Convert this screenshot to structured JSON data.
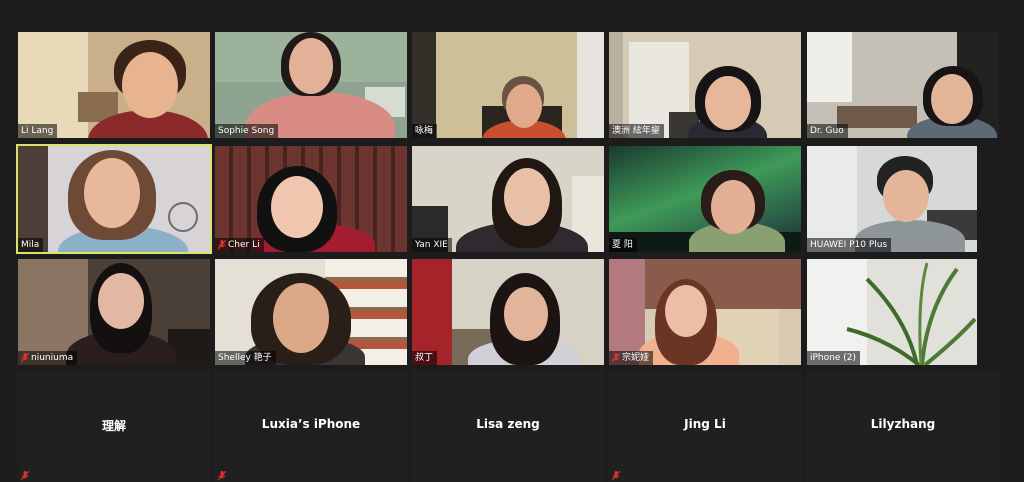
{
  "colors": {
    "background": "#1c1c1c",
    "active_speaker_border": "#d9e36a",
    "muted_icon": "#e0332b"
  },
  "row1": [
    {
      "name": "Li Lang",
      "muted": false
    },
    {
      "name": "Sophie Song",
      "muted": false
    },
    {
      "name": "咏梅",
      "muted": false
    },
    {
      "name": "澳洲 絃年鋆",
      "muted": false
    },
    {
      "name": "Dr. Guo",
      "muted": false
    }
  ],
  "row2": [
    {
      "name": "Mila",
      "muted": false,
      "active": true
    },
    {
      "name": "Cher Li",
      "muted": true
    },
    {
      "name": "Yan XIE",
      "muted": false
    },
    {
      "name": "夏 阳",
      "muted": false
    },
    {
      "name": "HUAWEI P10 Plus",
      "muted": false
    }
  ],
  "row3": [
    {
      "name": "niuniuma",
      "muted": true
    },
    {
      "name": "Shelley 艳子",
      "muted": false
    },
    {
      "name": "叔丁",
      "muted": false
    },
    {
      "name": "宗妮娅",
      "muted": true
    },
    {
      "name": "iPhone (2)",
      "muted": false
    }
  ],
  "row4": [
    {
      "name": "理解",
      "muted": true
    },
    {
      "name": "Luxia’s iPhone",
      "muted": true
    },
    {
      "name": "Lisa zeng",
      "muted": false
    },
    {
      "name": "Jing Li",
      "muted": true
    },
    {
      "name": "Lilyzhang",
      "muted": false
    }
  ]
}
